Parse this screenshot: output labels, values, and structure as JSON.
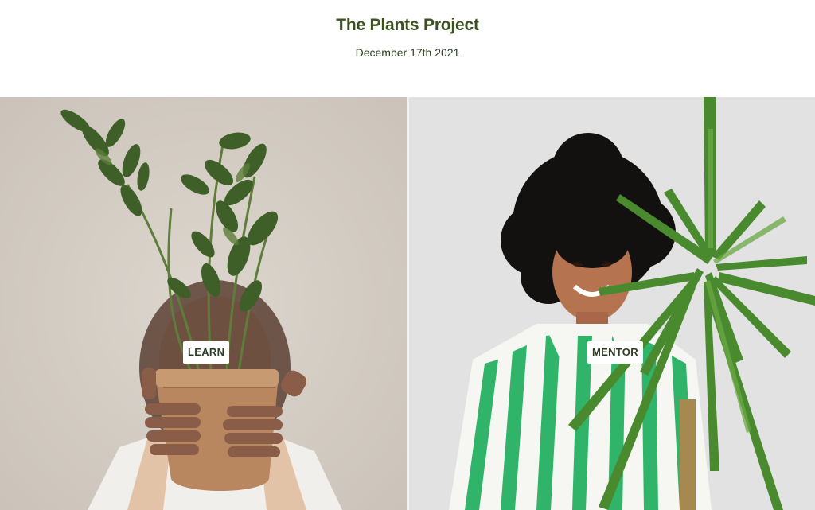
{
  "header": {
    "title": "The Plants Project",
    "date": "December 17th 2021"
  },
  "panels": [
    {
      "id": "learn",
      "button_label": "LEARN",
      "image_subject": "person-holding-potted-plant-photo"
    },
    {
      "id": "mentor",
      "button_label": "MENTOR",
      "image_subject": "smiling-woman-with-palm-plant-photo"
    }
  ],
  "colors": {
    "title": "#3a5220",
    "left_bg": "#d6cfc7",
    "right_bg": "#e1e1e1",
    "stripe_green": "#2fb46a",
    "leaf_green": "#3f6b2a"
  }
}
